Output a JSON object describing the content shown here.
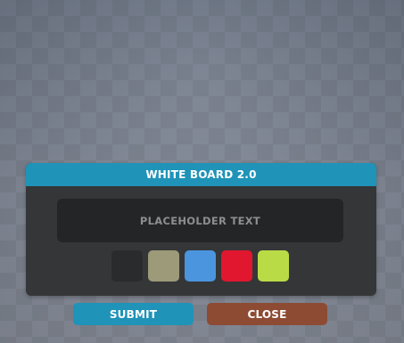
{
  "dialog": {
    "title": "WHITE BOARD 2.0",
    "placeholder": "PLACEHOLDER TEXT"
  },
  "swatches": [
    {
      "name": "black",
      "color": "#2a2b2d"
    },
    {
      "name": "olive",
      "color": "#9c9a78"
    },
    {
      "name": "blue",
      "color": "#4b95de"
    },
    {
      "name": "red",
      "color": "#e0172f"
    },
    {
      "name": "lime",
      "color": "#b9db46"
    }
  ],
  "buttons": {
    "submit_label": "SUBMIT",
    "close_label": "CLOSE"
  },
  "colors": {
    "header": "#1f93b8",
    "submit": "#1f93b8",
    "close": "#8e4b33",
    "panel": "#353638"
  }
}
